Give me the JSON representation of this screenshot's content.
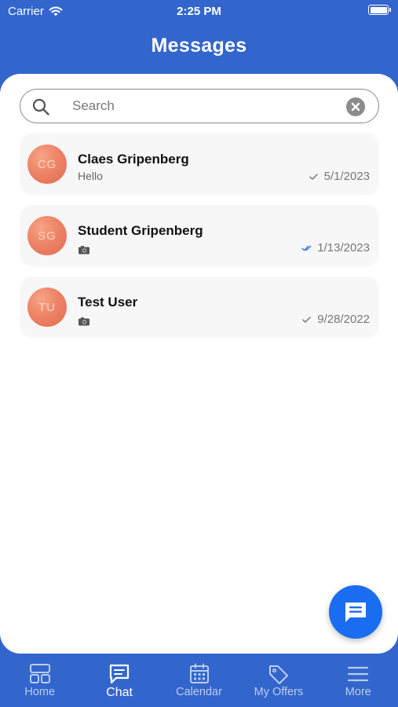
{
  "status_bar": {
    "carrier": "Carrier",
    "time": "2:25 PM"
  },
  "header": {
    "title": "Messages"
  },
  "search": {
    "placeholder": "Search",
    "value": ""
  },
  "chats": [
    {
      "initials": "CG",
      "name": "Claes Gripenberg",
      "preview": "Hello",
      "preview_type": "text",
      "date": "5/1/2023",
      "read_state": "sent"
    },
    {
      "initials": "SG",
      "name": "Student Gripenberg",
      "preview": "",
      "preview_type": "camera-icon",
      "date": "1/13/2023",
      "read_state": "read"
    },
    {
      "initials": "TU",
      "name": "Test User",
      "preview": "",
      "preview_type": "camera-icon",
      "date": "9/28/2022",
      "read_state": "sent"
    }
  ],
  "tabs": [
    {
      "label": "Home",
      "icon": "home-grid-icon",
      "active": false
    },
    {
      "label": "Chat",
      "icon": "chat-icon",
      "active": true
    },
    {
      "label": "Calendar",
      "icon": "calendar-icon",
      "active": false
    },
    {
      "label": "My Offers",
      "icon": "tag-icon",
      "active": false
    },
    {
      "label": "More",
      "icon": "menu-icon",
      "active": false
    }
  ],
  "colors": {
    "primary": "#3366cc",
    "fab": "#1a6cf0",
    "read_check": "#2f6fe0",
    "sent_check": "#777777"
  }
}
